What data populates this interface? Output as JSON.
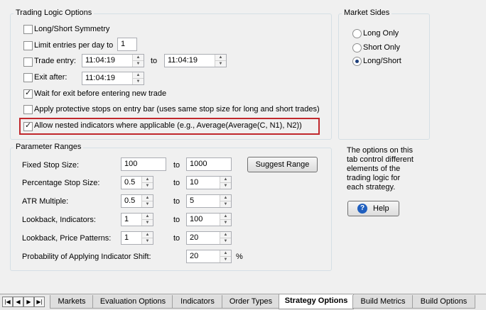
{
  "trading_logic": {
    "title": "Trading Logic Options",
    "long_short_symmetry": {
      "label": "Long/Short Symmetry",
      "checked": false
    },
    "limit_entries": {
      "label": "Limit entries per day to",
      "checked": false,
      "value": "1"
    },
    "trade_entry": {
      "label": "Trade entry:",
      "checked": false,
      "from": "11:04:19",
      "to_label": "to",
      "to": "11:04:19"
    },
    "exit_after": {
      "label": "Exit after:",
      "checked": false,
      "value": "11:04:19"
    },
    "wait_for_exit": {
      "label": "Wait for exit before entering new trade",
      "checked": true
    },
    "protective_stops": {
      "label": "Apply protective stops on entry bar (uses same stop size for long and short trades)",
      "checked": false
    },
    "nested_indicators": {
      "label": "Allow nested indicators where applicable (e.g., Average(Average(C, N1), N2))",
      "checked": true
    }
  },
  "market_sides": {
    "title": "Market Sides",
    "options": [
      {
        "label": "Long Only",
        "selected": false
      },
      {
        "label": "Short Only",
        "selected": false
      },
      {
        "label": "Long/Short",
        "selected": true
      }
    ]
  },
  "parameter_ranges": {
    "title": "Parameter Ranges",
    "to_label": "to",
    "fixed_stop": {
      "label": "Fixed Stop Size:",
      "from": "100",
      "to": "1000"
    },
    "suggest_range": "Suggest Range",
    "percentage_stop": {
      "label": "Percentage Stop Size:",
      "from": "0.5",
      "to": "10"
    },
    "atr_multiple": {
      "label": "ATR Multiple:",
      "from": "0.5",
      "to": "5"
    },
    "lookback_indicators": {
      "label": "Lookback, Indicators:",
      "from": "1",
      "to": "100"
    },
    "lookback_patterns": {
      "label": "Lookback, Price Patterns:",
      "from": "1",
      "to": "20"
    },
    "indicator_shift": {
      "label": "Probability of Applying Indicator Shift:",
      "value": "20",
      "unit": "%"
    }
  },
  "info": {
    "text": "The options on this tab control different elements of the trading logic for each strategy.",
    "help_label": "Help"
  },
  "tabs": [
    {
      "label": "Markets",
      "active": false
    },
    {
      "label": "Evaluation Options",
      "active": false
    },
    {
      "label": "Indicators",
      "active": false
    },
    {
      "label": "Order Types",
      "active": false
    },
    {
      "label": "Strategy Options",
      "active": true
    },
    {
      "label": "Build Metrics",
      "active": false
    },
    {
      "label": "Build Options",
      "active": false
    }
  ],
  "colors": {
    "highlight_border": "#c0282d",
    "help_icon": "#1f5fbf"
  }
}
